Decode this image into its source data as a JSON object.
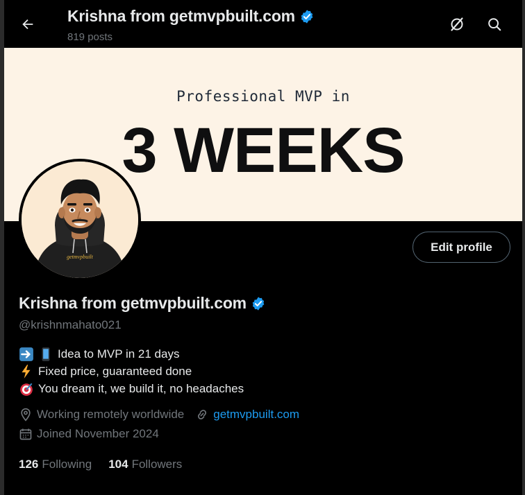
{
  "header": {
    "name": "Krishna from getmvpbuilt.com",
    "posts": "819 posts",
    "back_icon": "arrow-left-icon",
    "grok_icon": "slash-circle-icon",
    "search_icon": "search-icon"
  },
  "banner": {
    "subtitle": "Professional MVP in",
    "headline": "3 WEEKS",
    "background": "#fdf3e6"
  },
  "avatar": {
    "shirt_text": "getmvpbuilt"
  },
  "profile": {
    "edit_label": "Edit profile",
    "name": "Krishna from getmvpbuilt.com",
    "handle": "@krishnmahato021",
    "bio": [
      "Idea to MVP in 21 days",
      "Fixed price, guaranteed done",
      "You dream it, we build it, no headaches"
    ],
    "location": "Working remotely worldwide",
    "website": "getmvpbuilt.com",
    "joined": "Joined November 2024",
    "following_count": "126",
    "following_label": "Following",
    "followers_count": "104",
    "followers_label": "Followers"
  },
  "colors": {
    "accent": "#1d9bf0",
    "muted": "#71767b",
    "text": "#e7e9ea",
    "background": "#000000"
  }
}
